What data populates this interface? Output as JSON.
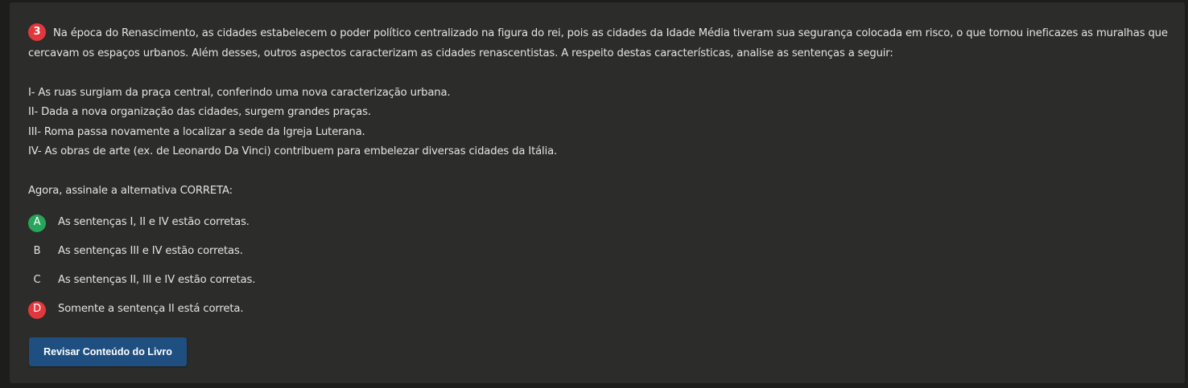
{
  "question": {
    "number": "3",
    "intro": "Na época do Renascimento, as cidades estabelecem o poder político centralizado na figura do rei, pois as cidades da Idade Média tiveram sua segurança colocada em risco, o que tornou ineficazes as muralhas que cercavam os espaços urbanos. Além desses, outros aspectos caracterizam as cidades renascentistas. A respeito destas características, analise as sentenças a seguir:",
    "statements": [
      "I- As ruas surgiam da praça central, conferindo uma nova caracterização urbana.",
      "II- Dada a nova organização das cidades, surgem grandes praças.",
      "III- Roma passa novamente a localizar a sede da Igreja Luterana.",
      "IV- As obras de arte (ex. de Leonardo Da Vinci) contribuem para embelezar diversas cidades da Itália."
    ],
    "prompt": "Agora, assinale a alternativa CORRETA:",
    "options": [
      {
        "letter": "A",
        "text": "As sentenças I, II e IV estão corretas.",
        "state": "correct"
      },
      {
        "letter": "B",
        "text": "As sentenças III e IV estão corretas.",
        "state": "neutral"
      },
      {
        "letter": "C",
        "text": "As sentenças II, III e IV estão corretas.",
        "state": "neutral"
      },
      {
        "letter": "D",
        "text": "Somente a sentença II está correta.",
        "state": "wrong"
      }
    ]
  },
  "review_button_label": "Revisar Conteúdo do Livro",
  "colors": {
    "correct": "#27a55a",
    "wrong": "#e0383d",
    "button": "#1f4f80",
    "card": "#2c2c2a"
  }
}
